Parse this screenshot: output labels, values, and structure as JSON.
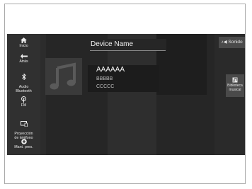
{
  "sidebar": {
    "items": [
      {
        "label": "Inicio",
        "icon": "home-icon"
      },
      {
        "label": "Atrás",
        "icon": "back-arrow-icon"
      },
      {
        "label": "Audio\nBluetooth",
        "icon": "bluetooth-icon"
      },
      {
        "label": "FM",
        "icon": "radio-antenna-icon"
      },
      {
        "label": "Proyección\nde teléfono",
        "icon": "phone-projection-icon"
      },
      {
        "label": "Mant. pres.",
        "icon": "plus-circle-icon"
      }
    ]
  },
  "header": {
    "device_name": "Device Name",
    "sound_label": "Sonido",
    "sound_icon": "sound-eq-icon"
  },
  "now_playing": {
    "title": "AAAAAA",
    "artist": "BBBBB",
    "album": "CCCCC",
    "album_art_icon": "music-note-icon"
  },
  "library": {
    "label": "Biblioteca\nmusical",
    "icon": "music-library-icon"
  },
  "colors": {
    "screen_bg": "#262626",
    "sidebar_bg": "#303030",
    "button_bg": "#4a4a4a"
  }
}
